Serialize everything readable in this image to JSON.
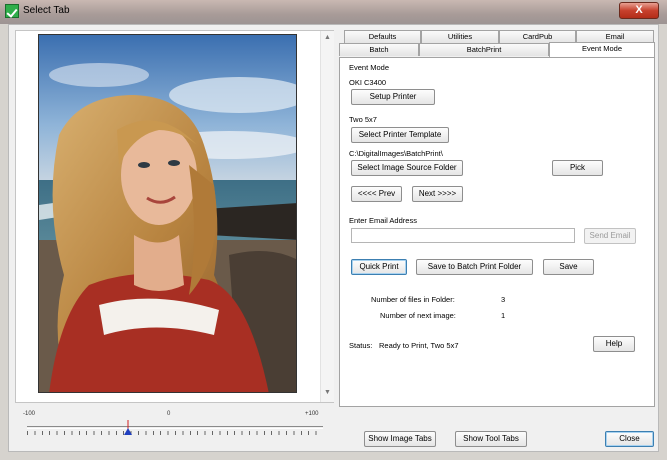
{
  "window": {
    "title": "Select Tab",
    "close_glyph": "X"
  },
  "slider": {
    "min_label": "-100",
    "mid_label": "0",
    "max_label": "+100",
    "value": -20
  },
  "tabs": {
    "row1": [
      "Defaults",
      "Utilities",
      "CardPub",
      "Email"
    ],
    "row2": [
      "Batch",
      "BatchPrint",
      "Event Mode"
    ],
    "active": "Event Mode"
  },
  "event_mode": {
    "heading": "Event Mode",
    "printer_name": "OKI C3400",
    "setup_printer": "Setup Printer",
    "template_name": "Two 5x7",
    "select_template": "Select Printer Template",
    "source_path": "C:\\DigitalImages\\BatchPrint\\",
    "select_source": "Select Image Source Folder",
    "pick": "Pick",
    "prev": "<<<< Prev",
    "next": "Next >>>>",
    "email_label": "Enter Email Address",
    "email_value": "",
    "send_email": "Send Email",
    "quick_print": "Quick Print",
    "save_to_batch": "Save to Batch Print Folder",
    "save": "Save",
    "files_label": "Number of files in Folder:",
    "files_value": "3",
    "next_image_label": "Number of next image:",
    "next_image_value": "1",
    "status_label": "Status:",
    "status_value": "Ready to Print, Two 5x7",
    "help": "Help"
  },
  "bottom": {
    "show_image_tabs": "Show Image Tabs",
    "show_tool_tabs": "Show Tool Tabs",
    "close": "Close"
  },
  "icons": {
    "app": "green-check-icon",
    "scroll_up": "scroll-up-arrow-icon",
    "scroll_down": "scroll-down-arrow-icon",
    "slider_thumb": "slider-thumb-icon"
  }
}
